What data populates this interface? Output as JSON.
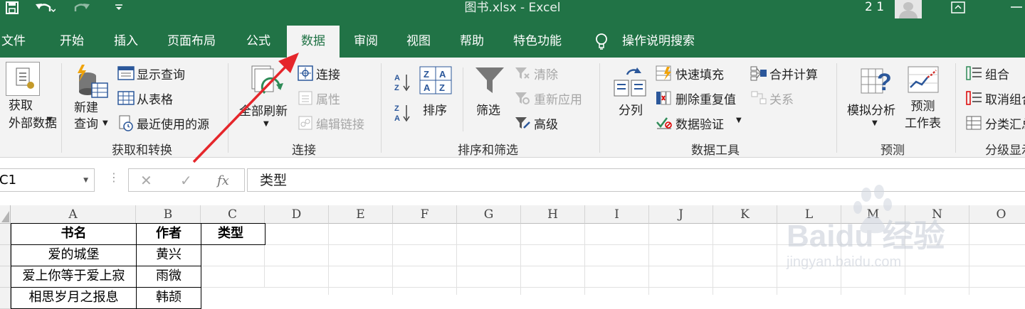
{
  "window": {
    "title": "图书.xlsx  -  Excel",
    "user_num": "2 1"
  },
  "tabs": [
    "文件",
    "开始",
    "插入",
    "页面布局",
    "公式",
    "数据",
    "审阅",
    "视图",
    "帮助",
    "特色功能",
    "操作说明搜索"
  ],
  "ribbon": {
    "get_external": "获取\n外部数据",
    "new_query": "新建\n查询",
    "show_queries": "显示查询",
    "from_table": "从表格",
    "recent_sources": "最近使用的源",
    "group_get_transform": "获取和转换",
    "refresh_all": "全部刷新",
    "connections": "连接",
    "properties": "属性",
    "edit_links": "编辑链接",
    "group_connections": "连接",
    "sort": "排序",
    "filter": "筛选",
    "clear": "清除",
    "reapply": "重新应用",
    "advanced": "高级",
    "group_sort_filter": "排序和筛选",
    "text_to_columns": "分列",
    "flash_fill": "快速填充",
    "remove_duplicates": "删除重复值",
    "data_validation": "数据验证",
    "consolidate": "合并计算",
    "relationships": "关系",
    "group_data_tools": "数据工具",
    "what_if": "模拟分析",
    "forecast_sheet": "预测\n工作表",
    "group_forecast": "预测",
    "group_btn": "组合",
    "ungroup": "取消组合",
    "subtotal": "分类汇总",
    "group_outline": "分级显示"
  },
  "formula_bar": {
    "name_box": "C1",
    "fx": "fx",
    "value": "类型"
  },
  "columns": [
    "A",
    "B",
    "C",
    "D",
    "E",
    "F",
    "G",
    "H",
    "I",
    "J",
    "K",
    "L",
    "M",
    "N",
    "O"
  ],
  "cells": {
    "a1": "书名",
    "b1": "作者",
    "c1": "类型",
    "a2": "爱的城堡",
    "b2": "黄兴",
    "a3": "爱上你等于爱上寂",
    "b3": "雨微",
    "a4": "相思岁月之报息",
    "b4": "韩颉"
  },
  "watermark": {
    "brand": "Baidu 经验",
    "url": "jingyan.baidu.com"
  },
  "colors": {
    "excel_green": "#217346",
    "arrow_red": "#e5262b"
  }
}
